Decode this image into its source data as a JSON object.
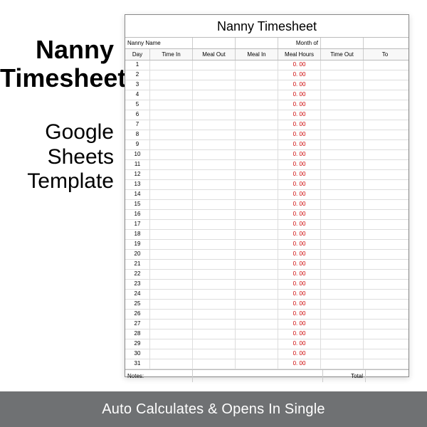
{
  "left": {
    "title_line1": "Nanny",
    "title_line2": "Timesheet",
    "sub_line1": "Google Sheets",
    "sub_line2": "Template"
  },
  "sheet": {
    "title": "Nanny Timesheet",
    "meta": {
      "nanny_name_label": "Nanny Name",
      "month_of_label": "Month of"
    },
    "columns": [
      "Day",
      "Time In",
      "Meal Out",
      "Meal In",
      "Meal Hours",
      "Time Out",
      "To"
    ],
    "days": [
      1,
      2,
      3,
      4,
      5,
      6,
      7,
      8,
      9,
      10,
      11,
      12,
      13,
      14,
      15,
      16,
      17,
      18,
      19,
      20,
      21,
      22,
      23,
      24,
      25,
      26,
      27,
      28,
      29,
      30,
      31
    ],
    "meal_hours_value": "0. 00",
    "footer": {
      "notes_label": "Notes:",
      "total_label": "Total"
    }
  },
  "banner": " Auto Calculates  & Opens In Single "
}
